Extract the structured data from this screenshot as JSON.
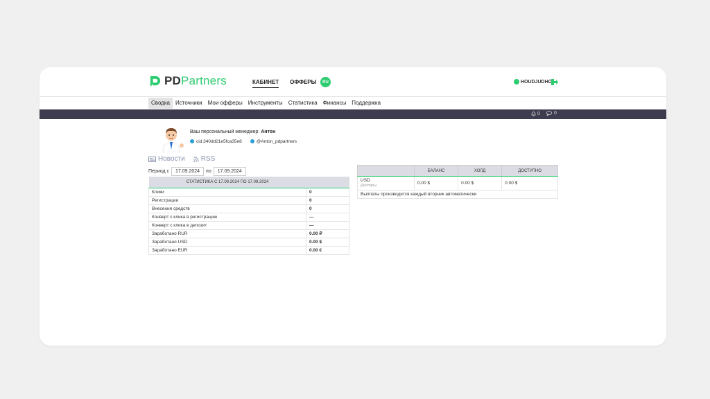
{
  "brand": {
    "logo_pd": "PD",
    "logo_partners": "Partners",
    "accent": "#2dcc70"
  },
  "topnav": {
    "items": [
      "КАБИНЕТ",
      "ОФФЕРЫ"
    ],
    "lang": "RU"
  },
  "user": {
    "name": "HOUDJUDHO"
  },
  "subnav": [
    "Сводка",
    "Источники",
    "Мои офферы",
    "Инструменты",
    "Статистика",
    "Финансы",
    "Поддержка"
  ],
  "notifications": {
    "bell_count": "0",
    "messages_count": "0"
  },
  "manager": {
    "label": "Ваш персональный менеджер:",
    "name": "Антон",
    "skype": "cid.340dd21e5fca35e8",
    "telegram": "@Anton_pdpartners"
  },
  "links": {
    "news": "Новости",
    "rss": "RSS"
  },
  "period": {
    "from_label": "Период с",
    "from": "17.09.2024",
    "to_label": "по",
    "to": "17.09.2024"
  },
  "stats": {
    "header": "Статистика с 17.09.2024 по 17.09.2024",
    "rows": [
      {
        "label": "Клики",
        "value": "0"
      },
      {
        "label": "Регистрации",
        "value": "0"
      },
      {
        "label": "Внесения средств",
        "value": "0"
      },
      {
        "label": "Конверт с клика в регистрацию",
        "value": "—"
      },
      {
        "label": "Конверт с клика в депозит",
        "value": "—"
      },
      {
        "label": "Заработано RUR",
        "value": "0.00 ₽"
      },
      {
        "label": "Заработано USD",
        "value": "0.00 $"
      },
      {
        "label": "Заработано EUR",
        "value": "0.00 €"
      }
    ]
  },
  "balance": {
    "headers": [
      "Баланс",
      "Холд",
      "Доступно"
    ],
    "currency": "USD",
    "currency_sub": "Доллары",
    "values": [
      "0.00 $",
      "0.00 $",
      "0.00 $"
    ],
    "note": "Выплаты производятся каждый вторник автоматически"
  }
}
